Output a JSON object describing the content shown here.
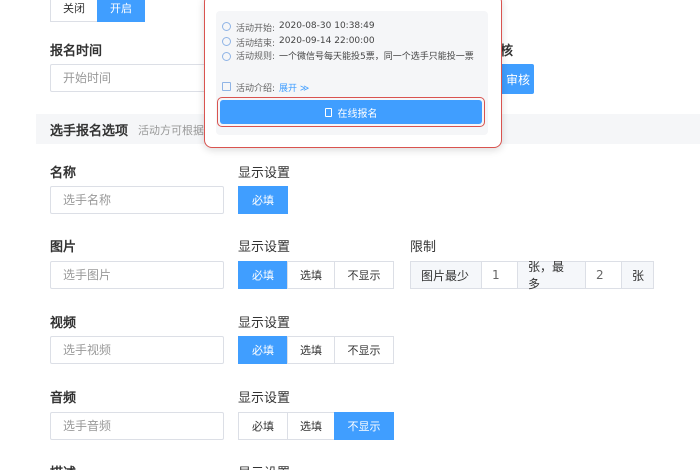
{
  "top_toggle": {
    "off_label": "关闭",
    "on_label": "开启"
  },
  "signup_time": {
    "label": "报名时间",
    "start_placeholder": "开始时间"
  },
  "audit": {
    "label_fragment": "核",
    "button_label": "审核"
  },
  "section": {
    "title": "选手报名选项",
    "hint": "活动方可根据"
  },
  "popup": {
    "start_key": "活动开始:",
    "start_value": "2020-08-30  10:38:49",
    "end_key": "活动结束:",
    "end_value": "2020-09-14  22:00:00",
    "rule_key": "活动规则:",
    "rule_value": "一个微信号每天能投5票，同一个选手只能投一票",
    "intro_key": "活动介绍:",
    "intro_expand": "展开 ≫",
    "signup_button": "在线报名"
  },
  "fields": [
    {
      "label": "名称",
      "placeholder": "选手名称",
      "display_label": "显示设置",
      "options": [
        "必填"
      ],
      "selected": 0
    },
    {
      "label": "图片",
      "placeholder": "选手图片",
      "display_label": "显示设置",
      "options": [
        "必填",
        "选填",
        "不显示"
      ],
      "selected": 0
    },
    {
      "label": "视频",
      "placeholder": "选手视频",
      "display_label": "显示设置",
      "options": [
        "必填",
        "选填",
        "不显示"
      ],
      "selected": 0
    },
    {
      "label": "音频",
      "placeholder": "选手音频",
      "display_label": "显示设置",
      "options": [
        "必填",
        "选填",
        "不显示"
      ],
      "selected": 2
    },
    {
      "label": "描述",
      "display_label": "显示设置"
    }
  ],
  "limit": {
    "label": "限制",
    "prefix": "图片最少",
    "min": "1",
    "mid": "张，最多",
    "max": "2",
    "suffix": "张"
  },
  "colors": {
    "accent": "#409eff",
    "popup_border": "#d9534f"
  }
}
